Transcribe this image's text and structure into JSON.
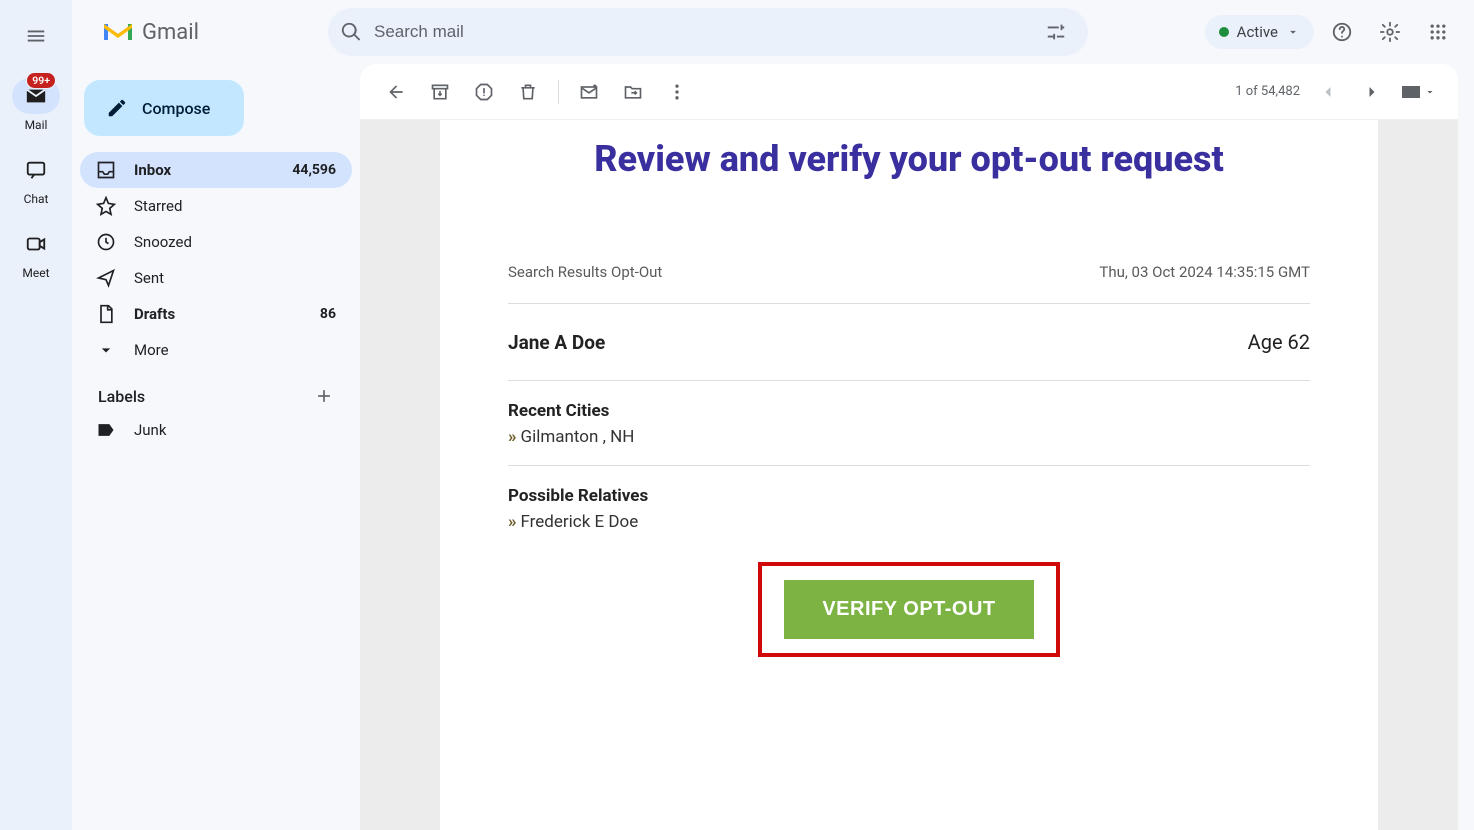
{
  "rail": {
    "apps": [
      {
        "key": "mail",
        "label": "Mail",
        "badge": "99+"
      },
      {
        "key": "chat",
        "label": "Chat"
      },
      {
        "key": "meet",
        "label": "Meet"
      }
    ]
  },
  "header": {
    "brand_name": "Gmail",
    "search_placeholder": "Search mail",
    "status_label": "Active"
  },
  "sidebar": {
    "compose_label": "Compose",
    "items": [
      {
        "key": "inbox",
        "label": "Inbox",
        "count": "44,596",
        "selected": true,
        "bold": true
      },
      {
        "key": "starred",
        "label": "Starred",
        "count": "",
        "selected": false,
        "bold": false
      },
      {
        "key": "snoozed",
        "label": "Snoozed",
        "count": "",
        "selected": false,
        "bold": false
      },
      {
        "key": "sent",
        "label": "Sent",
        "count": "",
        "selected": false,
        "bold": false
      },
      {
        "key": "drafts",
        "label": "Drafts",
        "count": "86",
        "selected": false,
        "bold": true
      },
      {
        "key": "more",
        "label": "More",
        "count": "",
        "selected": false,
        "bold": false
      }
    ],
    "labels_header": "Labels",
    "labels": [
      {
        "key": "junk",
        "label": "Junk"
      }
    ]
  },
  "toolbar": {
    "pager_text": "1 of 54,482"
  },
  "email": {
    "title": "Review and verify your opt-out request",
    "subject_line": "Search Results Opt-Out",
    "timestamp": "Thu, 03 Oct 2024 14:35:15 GMT",
    "person_name": "Jane A Doe",
    "person_age": "Age 62",
    "recent_cities_header": "Recent Cities",
    "recent_cities": [
      "Gilmanton , NH"
    ],
    "relatives_header": "Possible Relatives",
    "relatives": [
      "Frederick E Doe"
    ],
    "cta_label": "VERIFY OPT-OUT"
  }
}
